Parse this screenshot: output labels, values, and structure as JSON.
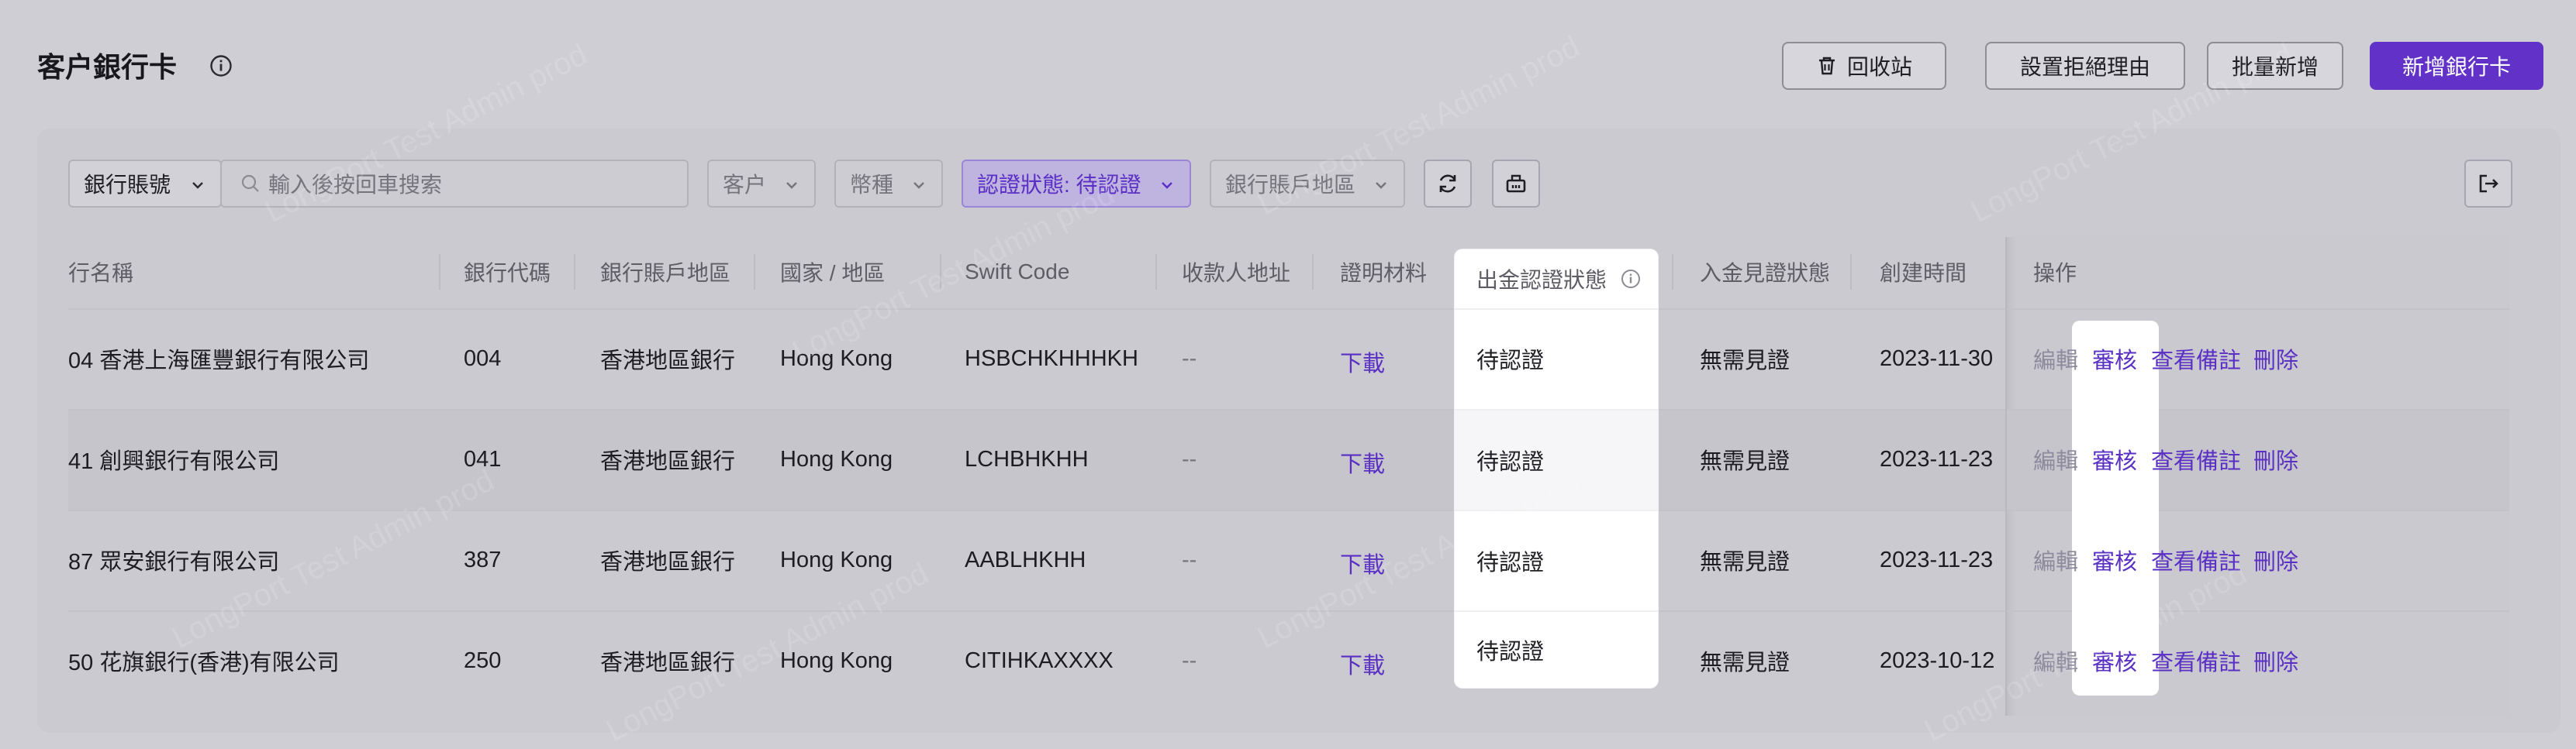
{
  "page": {
    "title": "客户銀行卡"
  },
  "header_buttons": {
    "recycle": "回收站",
    "reject_reason": "設置拒絕理由",
    "batch_add": "批量新增",
    "add_card": "新增銀行卡"
  },
  "filters": {
    "search_field_type": "銀行賬號",
    "search_placeholder": "輸入後按回車搜索",
    "customer": "客户",
    "currency": "幣種",
    "auth_status": "認證狀態: 待認證",
    "region": "銀行賬戶地區"
  },
  "table": {
    "headers": {
      "bank_name": "行名稱",
      "bank_code": "銀行代碼",
      "region": "銀行賬戶地區",
      "country": "國家 / 地區",
      "swift": "Swift Code",
      "payee_address": "收款人地址",
      "proof": "證明材料",
      "withdraw_status": "出金認證狀態",
      "deposit_status": "入金見證狀態",
      "created": "創建時間",
      "actions": "操作"
    },
    "rows": [
      {
        "bank_name": "04 香港上海匯豐銀行有限公司",
        "bank_code": "004",
        "region": "香港地區銀行",
        "country": "Hong Kong",
        "swift": "HSBCHKHHHKH",
        "payee_address": "--",
        "proof": "下載",
        "withdraw_status": "待認證",
        "deposit_status": "無需見證",
        "created": "2023-11-30"
      },
      {
        "bank_name": "41 創興銀行有限公司",
        "bank_code": "041",
        "region": "香港地區銀行",
        "country": "Hong Kong",
        "swift": "LCHBHKHH",
        "payee_address": "--",
        "proof": "下載",
        "withdraw_status": "待認證",
        "deposit_status": "無需見證",
        "created": "2023-11-23"
      },
      {
        "bank_name": "87 眾安銀行有限公司",
        "bank_code": "387",
        "region": "香港地區銀行",
        "country": "Hong Kong",
        "swift": "AABLHKHH",
        "payee_address": "--",
        "proof": "下載",
        "withdraw_status": "待認證",
        "deposit_status": "無需見證",
        "created": "2023-11-23"
      },
      {
        "bank_name": "50 花旗銀行(香港)有限公司",
        "bank_code": "250",
        "region": "香港地區銀行",
        "country": "Hong Kong",
        "swift": "CITIHKAXXXX",
        "payee_address": "--",
        "proof": "下載",
        "withdraw_status": "待認證",
        "deposit_status": "無需見證",
        "created": "2023-10-12"
      }
    ],
    "row_actions": {
      "edit": "編輯",
      "review": "審核",
      "view_notes": "查看備註",
      "delete": "刪除"
    }
  },
  "watermark": "LongPort Test Admin prod",
  "colors": {
    "accent": "#6232c8",
    "link": "#5a2fc4",
    "highlight": "#ffffff",
    "overlay": "#cfced5"
  }
}
